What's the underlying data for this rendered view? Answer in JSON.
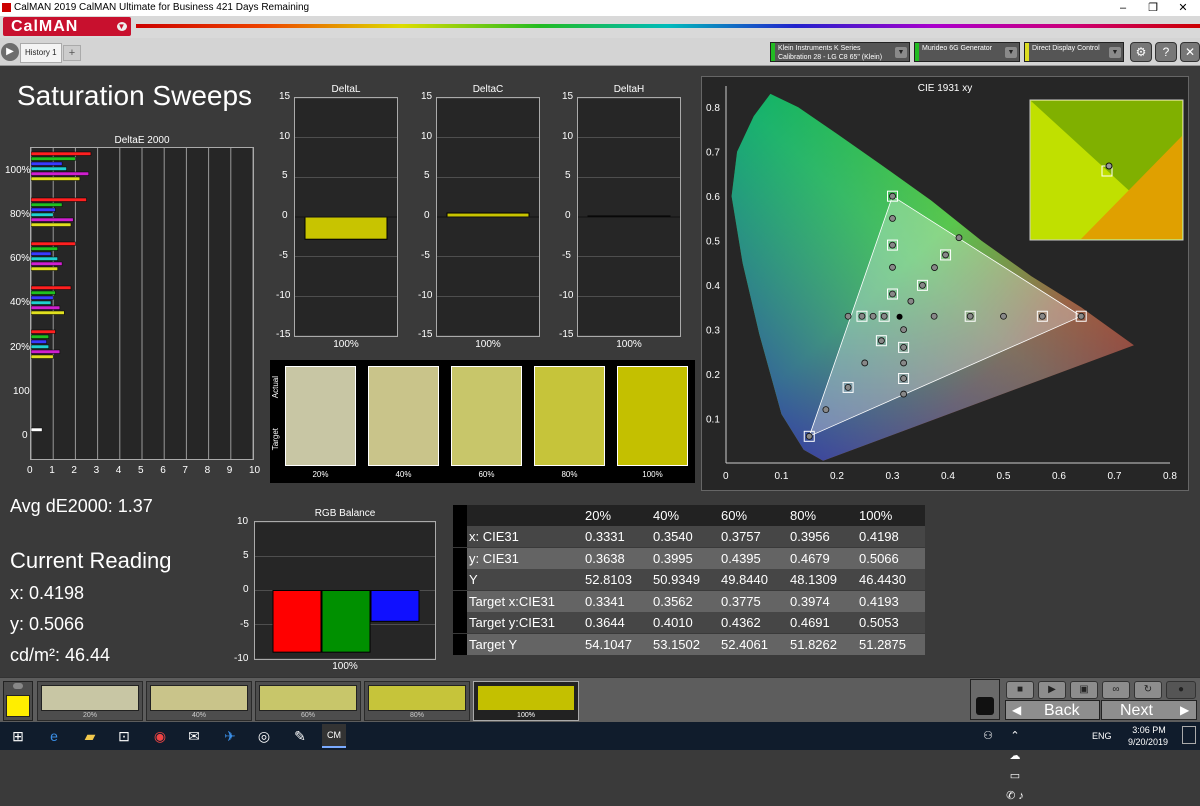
{
  "window": {
    "title": "CalMAN 2019 CalMAN Ultimate for Business 421 Days Remaining",
    "controls": [
      "–",
      "❐",
      "✕"
    ]
  },
  "brand": {
    "logo": "CalMAN",
    "menu_arrow": "▼"
  },
  "toolbar": {
    "history_tab": "History 1",
    "add_tab": "+",
    "devices": [
      {
        "line1": "Klein Instruments K Series",
        "line2": "Calibration 28 - LG C8 65\" (Klein)",
        "color": "#22bb22"
      },
      {
        "line1": "Murideo 6G Generator",
        "line2": "",
        "color": "#22bb22"
      },
      {
        "line1": "Direct Display Control",
        "line2": "",
        "color": "#dddd22"
      }
    ],
    "settings_icon": "⚙",
    "help_icon": "?",
    "close_icon": "✕"
  },
  "page": {
    "title": "Saturation Sweeps"
  },
  "deltaE": {
    "title": "DeltaE 2000",
    "ylabels": [
      "100%",
      "80%",
      "60%",
      "40%",
      "20%",
      "100",
      "0"
    ],
    "xlabels": [
      "0",
      "1",
      "2",
      "3",
      "4",
      "5",
      "6",
      "7",
      "8",
      "9",
      "10"
    ]
  },
  "deltaL": {
    "title": "DeltaL",
    "value": -2.8,
    "xlabel": "100%"
  },
  "deltaC": {
    "title": "DeltaC",
    "value": 0.5,
    "xlabel": "100%"
  },
  "deltaH": {
    "title": "DeltaH",
    "value": 0.0,
    "xlabel": "100%"
  },
  "delta_ticks": [
    "15",
    "10",
    "5",
    "0",
    "-5",
    "-10",
    "-15"
  ],
  "swatches": {
    "actual_label": "Actual",
    "target_label": "Target",
    "items": [
      {
        "label": "20%",
        "color": "#c8c6a4"
      },
      {
        "label": "40%",
        "color": "#c9c48a"
      },
      {
        "label": "60%",
        "color": "#c8c66a"
      },
      {
        "label": "80%",
        "color": "#c6c43a"
      },
      {
        "label": "100%",
        "color": "#c4c000"
      }
    ]
  },
  "avg_de": "Avg dE2000: 1.37",
  "reading": {
    "title": "Current Reading",
    "x": "x: 0.4198",
    "y": "y: 0.5066",
    "cd": "cd/m²: 46.44"
  },
  "rgb": {
    "title": "RGB Balance",
    "ticks": [
      "10",
      "5",
      "0",
      "-5",
      "-10"
    ],
    "xlabel": "100%",
    "values": {
      "red": -9,
      "green": -9,
      "blue": -4.5
    }
  },
  "cie": {
    "title": "CIE 1931 xy",
    "xticks": [
      "0",
      "0.1",
      "0.2",
      "0.3",
      "0.4",
      "0.5",
      "0.6",
      "0.7",
      "0.8"
    ],
    "yticks": [
      "0.8",
      "0.7",
      "0.6",
      "0.5",
      "0.4",
      "0.3",
      "0.2",
      "0.1"
    ]
  },
  "table": {
    "headers": [
      "",
      "20%",
      "40%",
      "60%",
      "80%",
      "100%"
    ],
    "rows": [
      [
        "x: CIE31",
        "0.3331",
        "0.3540",
        "0.3757",
        "0.3956",
        "0.4198"
      ],
      [
        "y: CIE31",
        "0.3638",
        "0.3995",
        "0.4395",
        "0.4679",
        "0.5066"
      ],
      [
        "Y",
        "52.8103",
        "50.9349",
        "49.8440",
        "48.1309",
        "46.4430"
      ],
      [
        "Target x:CIE31",
        "0.3341",
        "0.3562",
        "0.3775",
        "0.3974",
        "0.4193"
      ],
      [
        "Target y:CIE31",
        "0.3644",
        "0.4010",
        "0.4362",
        "0.4691",
        "0.5053"
      ],
      [
        "Target Y",
        "54.1047",
        "53.1502",
        "52.4061",
        "51.8262",
        "51.2875"
      ]
    ]
  },
  "bottom": {
    "swatches": [
      "20%",
      "40%",
      "60%",
      "80%",
      "100%"
    ],
    "back": "Back",
    "next": "Next",
    "current_color": "#ffee00"
  },
  "taskbar": {
    "lang": "ENG",
    "time": "3:06 PM",
    "date": "9/20/2019"
  },
  "chart_data": [
    {
      "type": "bar",
      "title": "DeltaE 2000",
      "orientation": "horizontal",
      "xlim": [
        0,
        10
      ],
      "categories": [
        "100%",
        "80%",
        "60%",
        "40%",
        "20%",
        "100"
      ],
      "series": [
        {
          "name": "Red",
          "values": [
            2.7,
            2.5,
            2.0,
            1.8,
            1.1,
            0
          ]
        },
        {
          "name": "Green",
          "values": [
            2.0,
            1.4,
            1.2,
            1.1,
            0.8,
            0
          ]
        },
        {
          "name": "Blue",
          "values": [
            1.4,
            1.1,
            0.9,
            1.0,
            0.7,
            0
          ]
        },
        {
          "name": "Cyan",
          "values": [
            1.6,
            1.0,
            1.2,
            0.9,
            0.8,
            0
          ]
        },
        {
          "name": "Magenta",
          "values": [
            2.6,
            1.9,
            1.4,
            1.3,
            1.3,
            0
          ]
        },
        {
          "name": "Yellow",
          "values": [
            2.2,
            1.8,
            1.2,
            1.5,
            1.0,
            0.5
          ]
        }
      ]
    },
    {
      "type": "bar",
      "title": "DeltaL",
      "categories": [
        "100%"
      ],
      "values": [
        -2.8
      ],
      "ylim": [
        -15,
        15
      ]
    },
    {
      "type": "bar",
      "title": "DeltaC",
      "categories": [
        "100%"
      ],
      "values": [
        0.5
      ],
      "ylim": [
        -15,
        15
      ]
    },
    {
      "type": "bar",
      "title": "DeltaH",
      "categories": [
        "100%"
      ],
      "values": [
        0
      ],
      "ylim": [
        -15,
        15
      ]
    },
    {
      "type": "bar",
      "title": "RGB Balance",
      "categories": [
        "100%"
      ],
      "series": [
        {
          "name": "Red",
          "values": [
            -9
          ]
        },
        {
          "name": "Green",
          "values": [
            -9
          ]
        },
        {
          "name": "Blue",
          "values": [
            -4.5
          ]
        }
      ],
      "ylim": [
        -10,
        10
      ]
    },
    {
      "type": "scatter",
      "title": "CIE 1931 xy",
      "xlim": [
        0,
        0.8
      ],
      "ylim": [
        0,
        0.85
      ],
      "gamut": [
        [
          0.64,
          0.33
        ],
        [
          0.3,
          0.6
        ],
        [
          0.15,
          0.06
        ]
      ],
      "points": [
        [
          0.3127,
          0.329
        ],
        [
          0.3331,
          0.3638
        ],
        [
          0.354,
          0.3995
        ],
        [
          0.3757,
          0.4395
        ],
        [
          0.3956,
          0.4679
        ],
        [
          0.4198,
          0.5066
        ],
        [
          0.3,
          0.6
        ],
        [
          0.3,
          0.55
        ],
        [
          0.3,
          0.49
        ],
        [
          0.3,
          0.44
        ],
        [
          0.3,
          0.38
        ],
        [
          0.64,
          0.33
        ],
        [
          0.57,
          0.33
        ],
        [
          0.5,
          0.33
        ],
        [
          0.44,
          0.33
        ],
        [
          0.375,
          0.33
        ],
        [
          0.15,
          0.06
        ],
        [
          0.18,
          0.12
        ],
        [
          0.22,
          0.17
        ],
        [
          0.25,
          0.225
        ],
        [
          0.28,
          0.275
        ],
        [
          0.22,
          0.33
        ],
        [
          0.245,
          0.33
        ],
        [
          0.265,
          0.33
        ],
        [
          0.285,
          0.33
        ],
        [
          0.32,
          0.155
        ],
        [
          0.32,
          0.19
        ],
        [
          0.32,
          0.225
        ],
        [
          0.32,
          0.26
        ],
        [
          0.32,
          0.3
        ]
      ]
    }
  ]
}
